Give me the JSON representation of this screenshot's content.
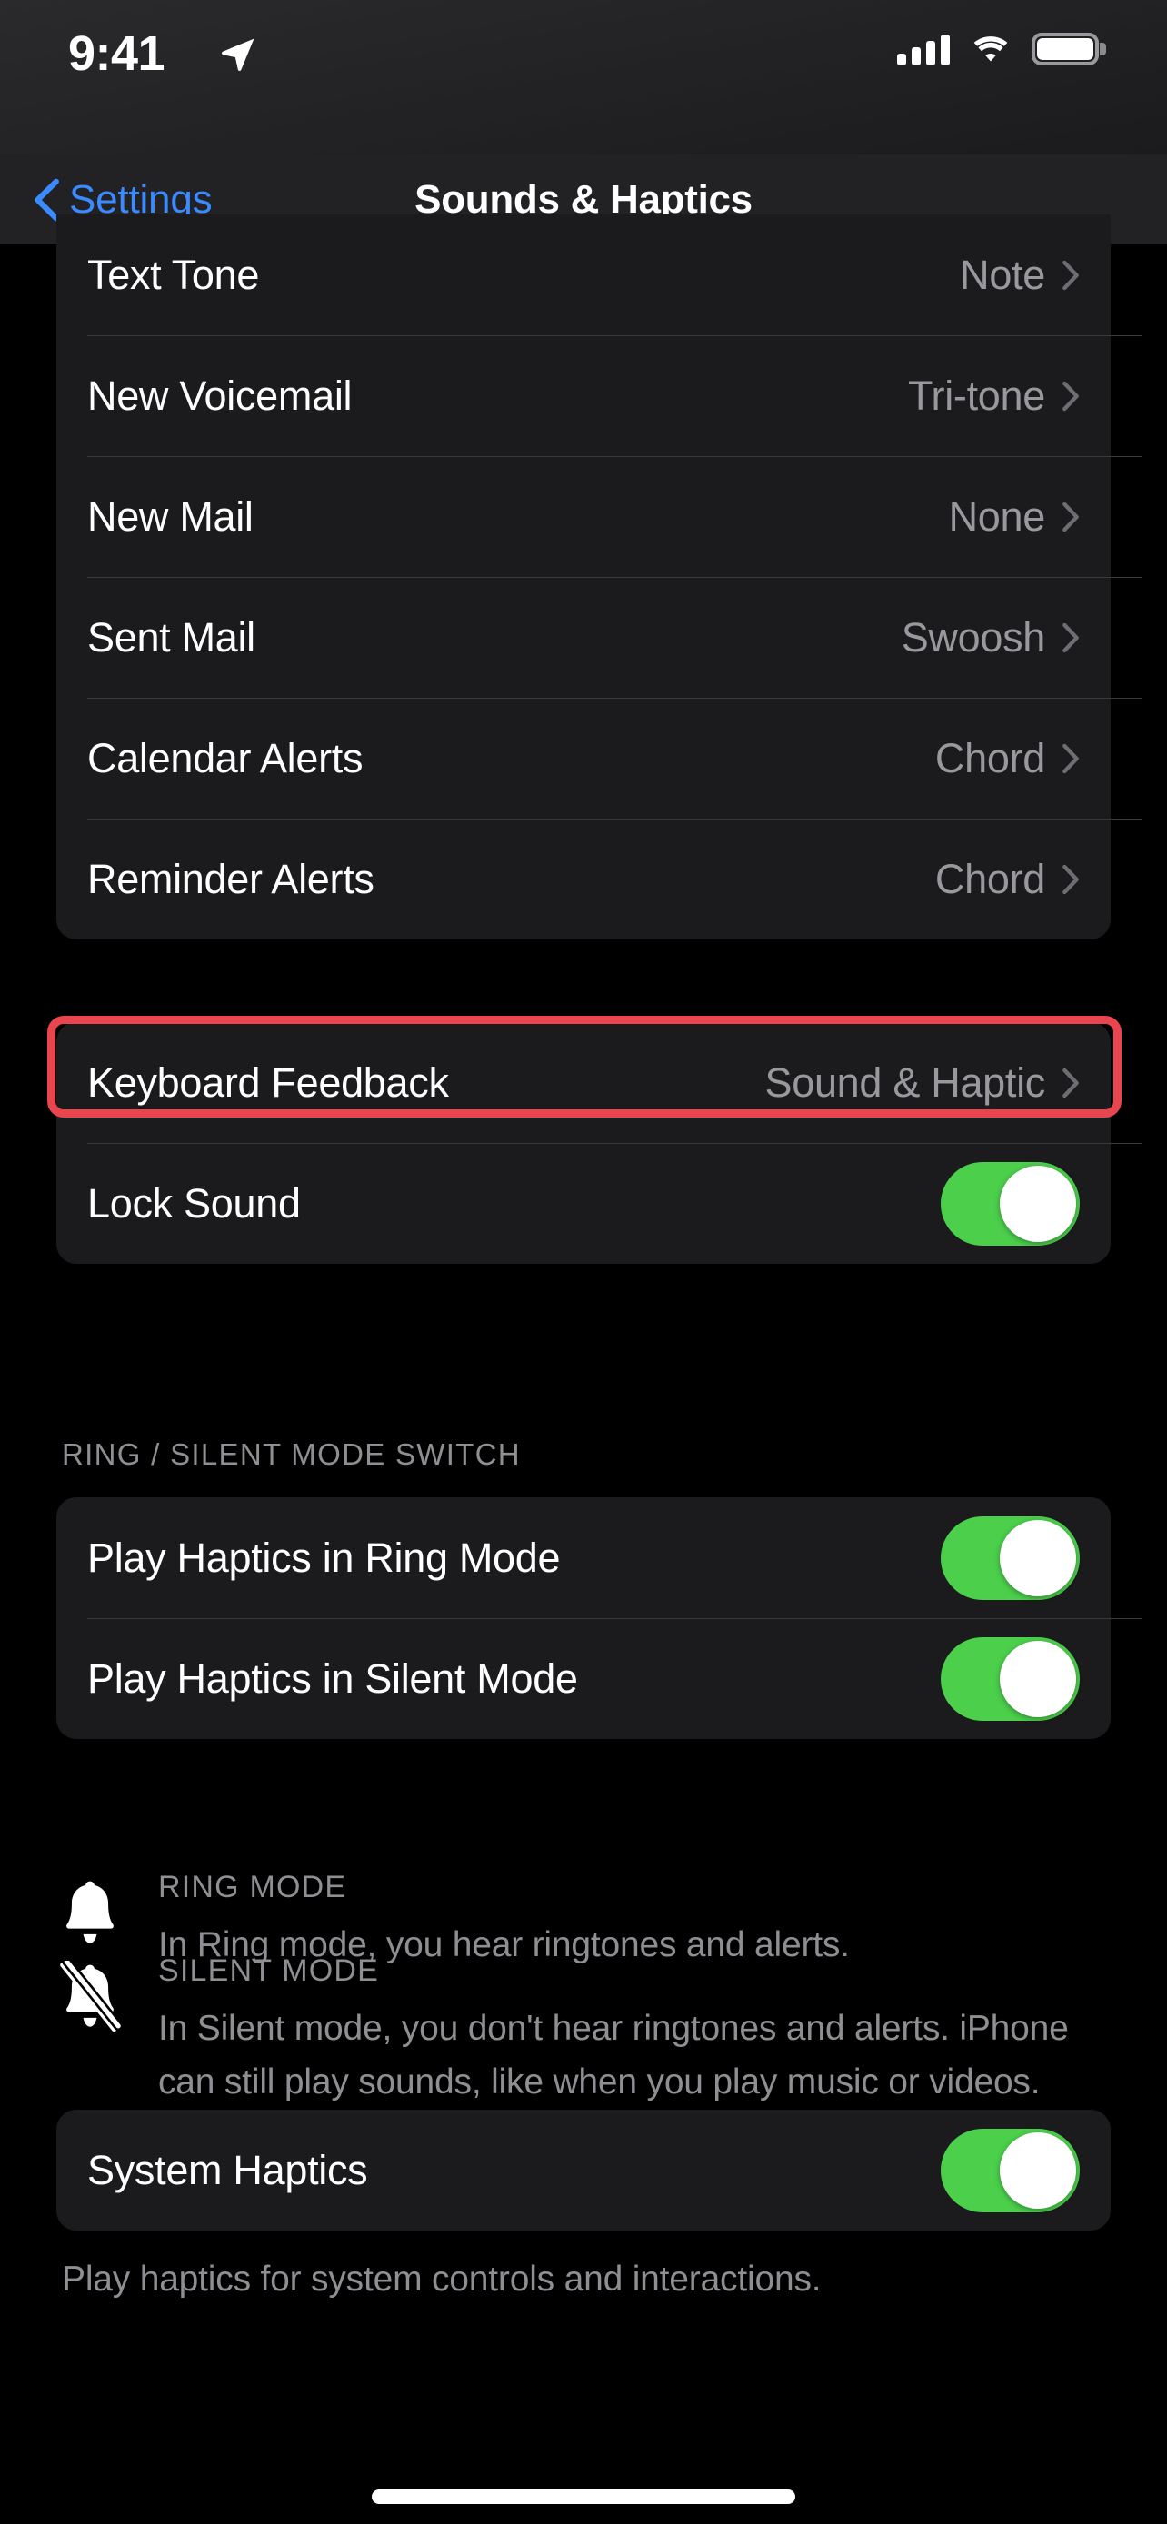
{
  "status_bar": {
    "time": "9:41",
    "location_icon": "location-arrow-icon",
    "cellular_icon": "cellular-signal-icon",
    "wifi_icon": "wifi-icon",
    "battery_icon": "battery-full-icon"
  },
  "nav": {
    "back_icon": "chevron-left-icon",
    "back_label": "Settings",
    "title": "Sounds & Haptics"
  },
  "sections": {
    "sounds": {
      "rows": [
        {
          "label": "Text Tone",
          "value": "Note",
          "accessory": "chevron-right-icon"
        },
        {
          "label": "New Voicemail",
          "value": "Tri-tone",
          "accessory": "chevron-right-icon"
        },
        {
          "label": "New Mail",
          "value": "None",
          "accessory": "chevron-right-icon"
        },
        {
          "label": "Sent Mail",
          "value": "Swoosh",
          "accessory": "chevron-right-icon"
        },
        {
          "label": "Calendar Alerts",
          "value": "Chord",
          "accessory": "chevron-right-icon"
        },
        {
          "label": "Reminder Alerts",
          "value": "Chord",
          "accessory": "chevron-right-icon"
        }
      ]
    },
    "keyboard": {
      "rows": [
        {
          "label": "Keyboard Feedback",
          "value": "Sound & Haptic",
          "accessory": "chevron-right-icon"
        },
        {
          "label": "Lock Sound",
          "value": "",
          "accessory": "toggle",
          "toggle_on": true
        }
      ]
    },
    "ring_silent": {
      "header": "RING / SILENT MODE SWITCH",
      "rows": [
        {
          "label": "Play Haptics in Ring Mode",
          "value": "",
          "accessory": "toggle",
          "toggle_on": true
        },
        {
          "label": "Play Haptics in Silent Mode",
          "value": "",
          "accessory": "toggle",
          "toggle_on": true
        }
      ]
    },
    "mode_info": [
      {
        "icon": "bell-icon",
        "title": "RING MODE",
        "description": "In Ring mode, you hear ringtones and alerts."
      },
      {
        "icon": "bell-slash-icon",
        "title": "SILENT MODE",
        "description": "In Silent mode, you don't hear ringtones and alerts. iPhone can still play sounds, like when you play music or videos."
      }
    ],
    "system_haptics": {
      "rows": [
        {
          "label": "System Haptics",
          "value": "",
          "accessory": "toggle",
          "toggle_on": true
        }
      ],
      "footnote": "Play haptics for system controls and interactions."
    }
  },
  "highlight": {
    "target": "Keyboard Feedback",
    "color": "#e8454e"
  },
  "colors": {
    "background": "#000000",
    "card": "#1b1b1d",
    "separator": "#3a3a3c",
    "primary_text": "#ffffff",
    "secondary_text": "#8e8e93",
    "value_text": "#98989d",
    "accent_blue": "#3b8aff",
    "toggle_on": "#4cd04c",
    "highlight_red": "#e8454e"
  },
  "home_indicator": "home-indicator"
}
